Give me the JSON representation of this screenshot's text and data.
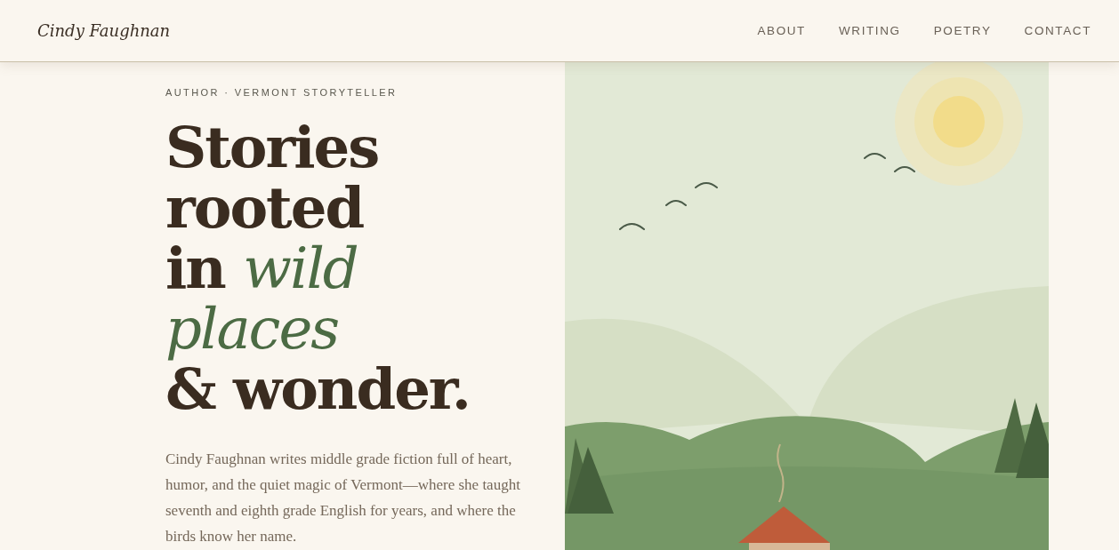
{
  "site_title": "Cindy Faughnan",
  "nav": [
    {
      "label": "ABOUT"
    },
    {
      "label": "WRITING"
    },
    {
      "label": "POETRY"
    },
    {
      "label": "CONTACT"
    }
  ],
  "hero": {
    "eyebrow": "AUTHOR · VERMONT STORYTELLER",
    "heading_lines": [
      "Stories",
      "rooted",
      "in *wild*",
      "*places*",
      "& wonder."
    ],
    "intro": "Cindy Faughnan writes middle grade fiction full of heart, humor, and the quiet magic of Vermont—where she taught seventh and eighth grade English for years, and where the birds know her name."
  }
}
